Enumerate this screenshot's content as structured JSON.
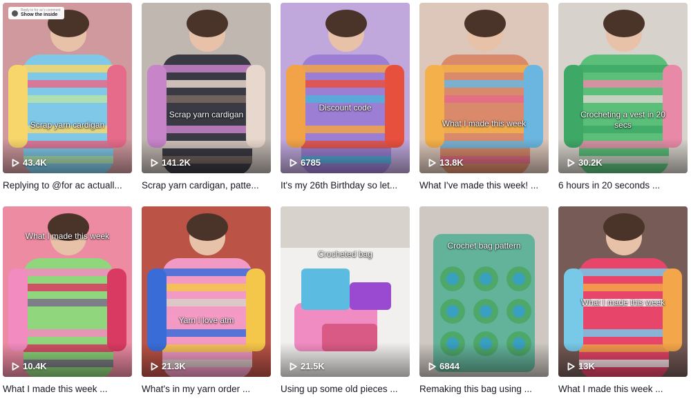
{
  "pinned_badge": {
    "subtitle": "Reply to for ac's comment",
    "label": "Show the inside"
  },
  "videos": [
    {
      "overlay": "Scrap yarn cardigan",
      "views": "43.4K",
      "caption": "Replying to @for ac actuall...",
      "colors": [
        "#f4a9b8",
        "#7fc8e8",
        "#f7d66b",
        "#e66a8a",
        "#b5e3a8",
        "#8a7a6a"
      ]
    },
    {
      "overlay": "Scrap yarn cardigan",
      "views": "141.2K",
      "caption": "Scrap yarn cardigan, patte...",
      "colors": [
        "#cfc6c0",
        "#3a3a44",
        "#c784c9",
        "#e8d7cc",
        "#7a6a60",
        "#a59a94"
      ]
    },
    {
      "overlay": "Discount code",
      "views": "6785",
      "caption": "It's my 26th Birthday so let...",
      "colors": [
        "#b89ae0",
        "#9c7fd4",
        "#f2a347",
        "#e8503e",
        "#4fb0d9",
        "#cfc4d6"
      ]
    },
    {
      "overlay": "What I made this week",
      "views": "13.8K",
      "caption": "What I've made this week! ...",
      "colors": [
        "#e8c9b8",
        "#d98a6a",
        "#f4b04a",
        "#6ab6e0",
        "#e46a8a",
        "#c9c3bd"
      ]
    },
    {
      "overlay": "Crocheting a vest in 20 secs",
      "views": "30.2K",
      "caption": "6 hours in 20 seconds ...",
      "colors": [
        "#f0ede8",
        "#5bbf7a",
        "#3ea866",
        "#e889a8",
        "#d9d5cc",
        "#a8a196"
      ]
    },
    {
      "overlay": "What I made this week",
      "views": "10.4K",
      "caption": "What I made this week ...",
      "colors": [
        "#e85a84",
        "#8fd67c",
        "#f28cc0",
        "#d93a62",
        "#7a6f8a",
        "#f5e7dc"
      ]
    },
    {
      "overlay": "Yarn I love atm",
      "views": "21.3K",
      "caption": "What's in my yarn order ...",
      "colors": [
        "#e84a3a",
        "#f39ac4",
        "#3a6cd8",
        "#f4c64a",
        "#d8cfc8",
        "#6a6460"
      ]
    },
    {
      "overlay": "Crocheted bag",
      "views": "21.5K",
      "caption": "Using up some old pieces ...",
      "colors": [
        "#e6e2dc",
        "#f18cc2",
        "#5bbbe0",
        "#9a4ad0",
        "#d95a84",
        "#b9b2ab"
      ]
    },
    {
      "overlay": "Crochet bag pattern",
      "views": "6844",
      "caption": "Remaking this bag using ...",
      "colors": [
        "#a78fb8",
        "#63b39a",
        "#4ea86a",
        "#c7b8d0",
        "#8a7a9a",
        "#d8d2cc"
      ]
    },
    {
      "overlay": "What I made this week",
      "views": "13K",
      "caption": "What I made this week ...",
      "colors": [
        "#3a2a2a",
        "#e8456a",
        "#78c8e8",
        "#f4a64a",
        "#ffffff",
        "#e8b8a8"
      ]
    }
  ]
}
